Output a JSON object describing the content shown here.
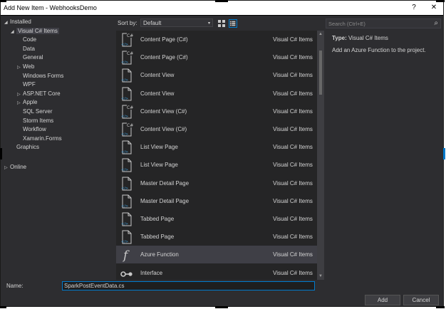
{
  "window": {
    "title": "Add New Item - WebhooksDemo",
    "help_label": "?",
    "close_label": "✕"
  },
  "tree": {
    "items": [
      {
        "label": "Installed",
        "arrow": "◢",
        "indent": 0
      },
      {
        "label": "Visual C# Items",
        "arrow": "◢",
        "indent": 1,
        "selected": true
      },
      {
        "label": "Code",
        "arrow": "",
        "indent": 2
      },
      {
        "label": "Data",
        "arrow": "",
        "indent": 2
      },
      {
        "label": "General",
        "arrow": "",
        "indent": 2
      },
      {
        "label": "Web",
        "arrow": "▷",
        "indent": 2
      },
      {
        "label": "Windows Forms",
        "arrow": "",
        "indent": 2
      },
      {
        "label": "WPF",
        "arrow": "",
        "indent": 2
      },
      {
        "label": "ASP.NET Core",
        "arrow": "▷",
        "indent": 2
      },
      {
        "label": "Apple",
        "arrow": "▷",
        "indent": 2
      },
      {
        "label": "SQL Server",
        "arrow": "",
        "indent": 2
      },
      {
        "label": "Storm Items",
        "arrow": "",
        "indent": 2
      },
      {
        "label": "Workflow",
        "arrow": "",
        "indent": 2
      },
      {
        "label": "Xamarin.Forms",
        "arrow": "",
        "indent": 2
      },
      {
        "label": "Graphics",
        "arrow": "",
        "indent": 1
      },
      {
        "label": "Online",
        "arrow": "▷",
        "indent": 0
      }
    ]
  },
  "sort": {
    "label": "Sort by:",
    "value": "Default",
    "caret": "▾"
  },
  "search": {
    "placeholder": "Search (Ctrl+E)",
    "icon": "⌕"
  },
  "templates": [
    {
      "name": "Content Page (C#)",
      "category": "Visual C# Items",
      "icon": "csharp-page"
    },
    {
      "name": "Content Page (C#)",
      "category": "Visual C# Items",
      "icon": "csharp-page"
    },
    {
      "name": "Content View",
      "category": "Visual C# Items",
      "icon": "xaml-page"
    },
    {
      "name": "Content View",
      "category": "Visual C# Items",
      "icon": "xaml-page"
    },
    {
      "name": "Content View (C#)",
      "category": "Visual C# Items",
      "icon": "csharp-page"
    },
    {
      "name": "Content View (C#)",
      "category": "Visual C# Items",
      "icon": "csharp-page"
    },
    {
      "name": "List View Page",
      "category": "Visual C# Items",
      "icon": "xaml-page"
    },
    {
      "name": "List View Page",
      "category": "Visual C# Items",
      "icon": "xaml-page"
    },
    {
      "name": "Master Detail Page",
      "category": "Visual C# Items",
      "icon": "xaml-page"
    },
    {
      "name": "Master Detail Page",
      "category": "Visual C# Items",
      "icon": "xaml-page"
    },
    {
      "name": "Tabbed Page",
      "category": "Visual C# Items",
      "icon": "xaml-page"
    },
    {
      "name": "Tabbed Page",
      "category": "Visual C# Items",
      "icon": "xaml-page"
    },
    {
      "name": "Azure Function",
      "category": "Visual C# Items",
      "icon": "function",
      "selected": true
    },
    {
      "name": "Interface",
      "category": "Visual C# Items",
      "icon": "interface"
    }
  ],
  "details": {
    "type_label": "Type:",
    "type_value": "Visual C# Items",
    "description": "Add an Azure Function to the project."
  },
  "name_field": {
    "label": "Name:",
    "value": "SparkPostEventData.cs"
  },
  "buttons": {
    "add": "Add",
    "cancel": "Cancel"
  },
  "colors": {
    "background": "#2d2d30",
    "list": "#252526",
    "selection": "#3f3f46",
    "accent": "#007acc"
  }
}
